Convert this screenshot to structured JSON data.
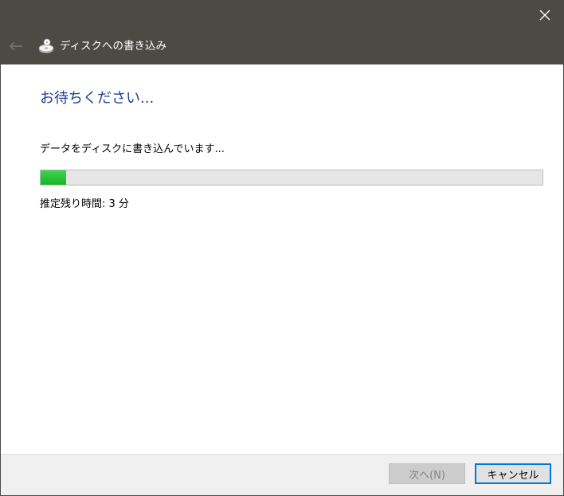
{
  "window": {
    "title": "ディスクへの書き込み",
    "close_icon": "close-icon",
    "back_icon": "back-arrow-icon",
    "app_icon": "disc-burn-icon"
  },
  "main": {
    "heading": "お待ちください...",
    "status": "データをディスクに書き込んでいます...",
    "progress_fraction": 0.05,
    "time_remaining": "推定残り時間: 3 分"
  },
  "footer": {
    "next_label": "次へ(N)",
    "cancel_label": "キャンセル"
  },
  "colors": {
    "titlebar": "#4d4a45",
    "heading": "#1c3f95",
    "progress": "#16b526",
    "accent": "#0078d7"
  }
}
